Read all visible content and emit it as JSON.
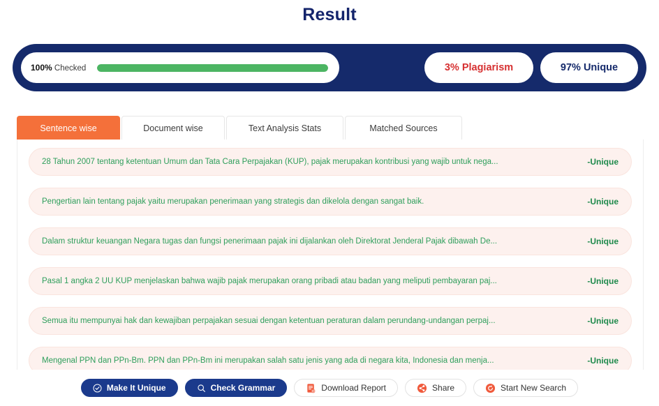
{
  "header": {
    "title": "Result"
  },
  "summary": {
    "progress": {
      "percent_label": "100%",
      "checked_label": "Checked",
      "percent_value": 100,
      "fill_color": "#4cb563"
    },
    "stats": [
      {
        "label": "3% Plagiarism",
        "value": 3,
        "kind": "plagiarism",
        "color": "#d63031"
      },
      {
        "label": "97% Unique",
        "value": 97,
        "kind": "unique",
        "color": "#152a6b"
      }
    ],
    "bar_color": "#152a6b"
  },
  "tabs": [
    {
      "label": "Sentence wise",
      "active": true
    },
    {
      "label": "Document wise",
      "active": false
    },
    {
      "label": "Text Analysis Stats",
      "active": false
    },
    {
      "label": "Matched Sources",
      "active": false
    }
  ],
  "results": {
    "rows": [
      {
        "text": "28 Tahun 2007 tentang ketentuan Umum dan Tata Cara Perpajakan (KUP), pajak merupakan kontribusi yang wajib untuk nega...",
        "tag": "-Unique"
      },
      {
        "text": "Pengertian lain tentang pajak yaitu merupakan penerimaan yang strategis dan dikelola dengan sangat baik.",
        "tag": "-Unique"
      },
      {
        "text": "Dalam struktur keuangan Negara tugas dan fungsi penerimaan pajak ini dijalankan oleh Direktorat Jenderal Pajak dibawah De...",
        "tag": "-Unique"
      },
      {
        "text": "Pasal 1 angka 2 UU KUP menjelaskan bahwa wajib pajak merupakan orang pribadi atau badan yang meliputi pembayaran paj...",
        "tag": "-Unique"
      },
      {
        "text": "Semua itu mempunyai hak dan kewajiban perpajakan sesuai dengan ketentuan peraturan dalam perundang-undangan perpaj...",
        "tag": "-Unique"
      },
      {
        "text": "Mengenal PPN dan PPn-Bm. PPN dan PPn-Bm ini merupakan salah satu jenis yang ada di negara kita, Indonesia dan menja...",
        "tag": "-Unique"
      }
    ]
  },
  "actions": [
    {
      "label": "Make It Unique",
      "icon": "check-circle-icon",
      "style": "primary"
    },
    {
      "label": "Check Grammar",
      "icon": "search-icon",
      "style": "primary"
    },
    {
      "label": "Download Report",
      "icon": "pdf-file-icon",
      "style": "ghost"
    },
    {
      "label": "Share",
      "icon": "share-icon",
      "style": "ghost"
    },
    {
      "label": "Start New Search",
      "icon": "refresh-circle-icon",
      "style": "ghost"
    }
  ]
}
